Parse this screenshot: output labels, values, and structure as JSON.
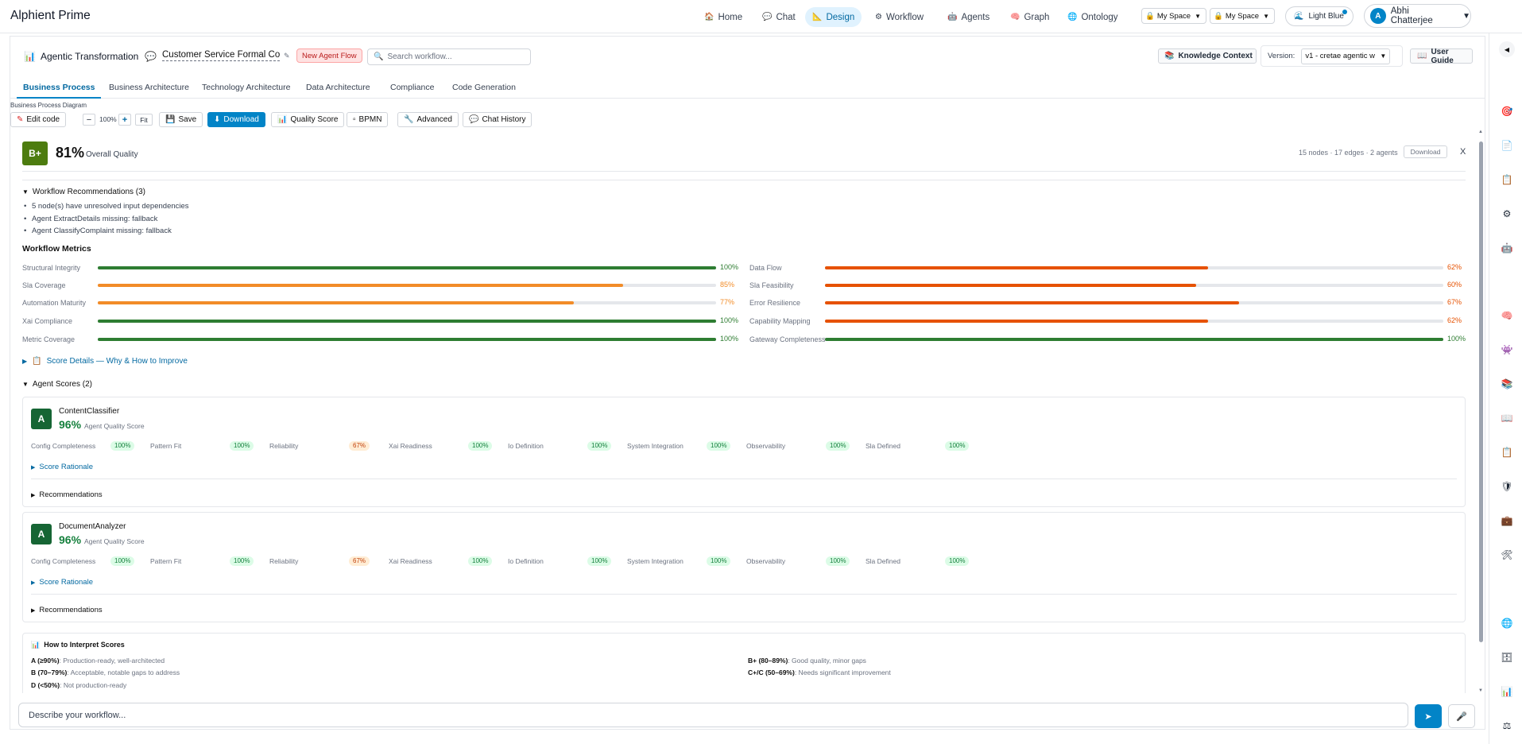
{
  "app": {
    "brand": "Alphient Prime"
  },
  "nav": {
    "items": [
      {
        "icon": "🏠",
        "label": "Home"
      },
      {
        "icon": "💬",
        "label": "Chat"
      },
      {
        "icon": "📐",
        "label": "Design"
      },
      {
        "icon": "⚙",
        "label": "Workflow"
      },
      {
        "icon": "🤖",
        "label": "Agents"
      },
      {
        "icon": "🧠",
        "label": "Graph"
      },
      {
        "icon": "🌐",
        "label": "Ontology"
      }
    ],
    "active": "Design",
    "space_select_1": "My Space",
    "space_select_2": "My Space",
    "theme_label": "Light Blue",
    "user_initial": "A",
    "user_name": "Abhi Chatterjee"
  },
  "header": {
    "title": "Agentic Transformation",
    "flow_name": "Customer Service Formal Co",
    "new_flow_button": "New Agent Flow",
    "search_placeholder": "Search workflow...",
    "knowledge_button": "Knowledge Context",
    "version_label": "Version:",
    "version_value": "v1 - cretae agentic w",
    "guide_button": "User Guide"
  },
  "tabs": [
    "Business Process",
    "Business Architecture",
    "Technology Architecture",
    "Data Architecture",
    "Compliance",
    "Code Generation"
  ],
  "toolbar": {
    "diagram_label": "Business Process Diagram",
    "edit_code": "Edit code",
    "zoom_level": "100%",
    "fit": "Fit",
    "save": "Save",
    "download": "Download",
    "quality_score": "Quality Score",
    "bpmn": "BPMN",
    "advanced": "Advanced",
    "chat_history": "Chat History"
  },
  "quality": {
    "grade": "B+",
    "overall_pct": "81%",
    "overall_label": "Overall Quality",
    "stats": "15 nodes · 17 edges · 2 agents",
    "download": "Download",
    "close": "X",
    "recommendations_title": "Workflow Recommendations (3)",
    "recommendations": [
      "5 node(s) have unresolved input dependencies",
      "Agent ExtractDetails missing: fallback",
      "Agent ClassifyComplaint missing: fallback"
    ],
    "metrics_title": "Workflow Metrics",
    "metrics_left": [
      {
        "label": "Structural Integrity",
        "value": 100,
        "display": "100%",
        "color": "#2e7d32"
      },
      {
        "label": "Sla Coverage",
        "value": 85,
        "display": "85%",
        "color": "#f28c28"
      },
      {
        "label": "Automation Maturity",
        "value": 77,
        "display": "77%",
        "color": "#f28c28"
      },
      {
        "label": "Xai Compliance",
        "value": 100,
        "display": "100%",
        "color": "#2e7d32"
      },
      {
        "label": "Metric Coverage",
        "value": 100,
        "display": "100%",
        "color": "#2e7d32"
      }
    ],
    "metrics_right": [
      {
        "label": "Data Flow",
        "value": 62,
        "display": "62%",
        "color": "#e65100"
      },
      {
        "label": "Sla Feasibility",
        "value": 60,
        "display": "60%",
        "color": "#e65100"
      },
      {
        "label": "Error Resilience",
        "value": 67,
        "display": "67%",
        "color": "#e65100"
      },
      {
        "label": "Capability Mapping",
        "value": 62,
        "display": "62%",
        "color": "#e65100"
      },
      {
        "label": "Gateway Completeness",
        "value": 100,
        "display": "100%",
        "color": "#2e7d32"
      }
    ],
    "score_details_link": "Score Details — Why & How to Improve",
    "agent_scores_title": "Agent Scores (2)",
    "agents": [
      {
        "grade": "A",
        "name": "ContentClassifier",
        "pct": "96%",
        "pct_label": "Agent Quality Score",
        "dims": [
          {
            "label": "Config Completeness",
            "value": "100%",
            "status": "good"
          },
          {
            "label": "Pattern Fit",
            "value": "100%",
            "status": "good"
          },
          {
            "label": "Reliability",
            "value": "67%",
            "status": "warn"
          },
          {
            "label": "Xai Readiness",
            "value": "100%",
            "status": "good"
          },
          {
            "label": "Io Definition",
            "value": "100%",
            "status": "good"
          },
          {
            "label": "System Integration",
            "value": "100%",
            "status": "good"
          },
          {
            "label": "Observability",
            "value": "100%",
            "status": "good"
          },
          {
            "label": "Sla Defined",
            "value": "100%",
            "status": "good"
          }
        ],
        "rationale": "Score Rationale",
        "recommendations": "Recommendations"
      },
      {
        "grade": "A",
        "name": "DocumentAnalyzer",
        "pct": "96%",
        "pct_label": "Agent Quality Score",
        "dims": [
          {
            "label": "Config Completeness",
            "value": "100%",
            "status": "good"
          },
          {
            "label": "Pattern Fit",
            "value": "100%",
            "status": "good"
          },
          {
            "label": "Reliability",
            "value": "67%",
            "status": "warn"
          },
          {
            "label": "Xai Readiness",
            "value": "100%",
            "status": "good"
          },
          {
            "label": "Io Definition",
            "value": "100%",
            "status": "good"
          },
          {
            "label": "System Integration",
            "value": "100%",
            "status": "good"
          },
          {
            "label": "Observability",
            "value": "100%",
            "status": "good"
          },
          {
            "label": "Sla Defined",
            "value": "100%",
            "status": "good"
          }
        ],
        "rationale": "Score Rationale",
        "recommendations": "Recommendations"
      }
    ],
    "interpret_title": "How to Interpret Scores",
    "interpret": [
      {
        "key": "A (≥90%)",
        "text": ": Production-ready, well-architected"
      },
      {
        "key": "B+ (80–89%)",
        "text": ": Good quality, minor gaps"
      },
      {
        "key": "B (70–79%)",
        "text": ": Acceptable, notable gaps to address"
      },
      {
        "key": "C+/C (50–69%)",
        "text": ": Needs significant improvement"
      },
      {
        "key": "D (<50%)",
        "text": ": Not production-ready"
      }
    ]
  },
  "chat": {
    "placeholder": "Describe your workflow..."
  },
  "rail_icons": [
    "target-icon",
    "document-icon",
    "clipboard-icon",
    "gear-icon",
    "robot-icon",
    "brain-icon",
    "robot-face-icon",
    "books-icon",
    "book-icon",
    "clipboard-icon",
    "shield-icon",
    "briefcase-icon",
    "tools-icon",
    "globe-icon",
    "storage-icon",
    "chart-icon",
    "scale-icon"
  ]
}
